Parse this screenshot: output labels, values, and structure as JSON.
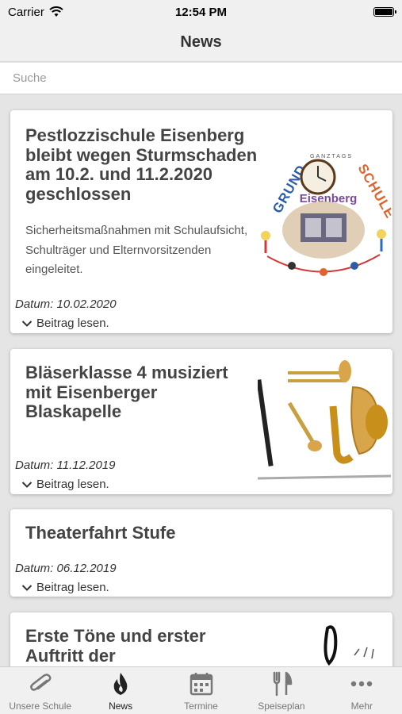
{
  "status_bar": {
    "carrier": "Carrier",
    "time": "12:54 PM"
  },
  "nav": {
    "title": "News"
  },
  "search": {
    "placeholder": "Suche"
  },
  "articles": [
    {
      "title": "Pestlozzischule Eisenberg bleibt wegen Sturmschaden am 10.2. und 11.2.2020 geschlossen",
      "excerpt": "Sicherheitsmaßnahmen mit Schulaufsicht, Schulträger und Elternvorsitzenden eingeleitet.",
      "date": "Datum: 10.02.2020",
      "read_more": "Beitrag lesen.",
      "image": "school-logo",
      "image_text": {
        "arc": "GANZTAGS",
        "grund": "GRUND",
        "schule": "SCHULE",
        "town": "Eisenberg"
      }
    },
    {
      "title": "Bläserklasse 4 musiziert mit Eisenberger Blaskapelle",
      "date": "Datum: 11.12.2019",
      "read_more": "Beitrag lesen.",
      "image": "brass-instruments"
    },
    {
      "title": "Theaterfahrt Stufe",
      "date": "Datum: 06.12.2019",
      "read_more": "Beitrag lesen."
    },
    {
      "title": "Erste Töne und erster Auftritt der",
      "image": "music-notes"
    }
  ],
  "tabs": [
    {
      "label": "Unsere Schule",
      "icon": "paperclip-icon",
      "active": false
    },
    {
      "label": "News",
      "icon": "flame-icon",
      "active": true
    },
    {
      "label": "Termine",
      "icon": "calendar-icon",
      "active": false
    },
    {
      "label": "Speiseplan",
      "icon": "fork-knife-icon",
      "active": false
    },
    {
      "label": "Mehr",
      "icon": "more-icon",
      "active": false
    }
  ],
  "colors": {
    "bar_bg": "#f0f0f0",
    "feed_bg": "#e5e5e5",
    "active_tab": "#222222",
    "inactive_tab": "#777777"
  }
}
